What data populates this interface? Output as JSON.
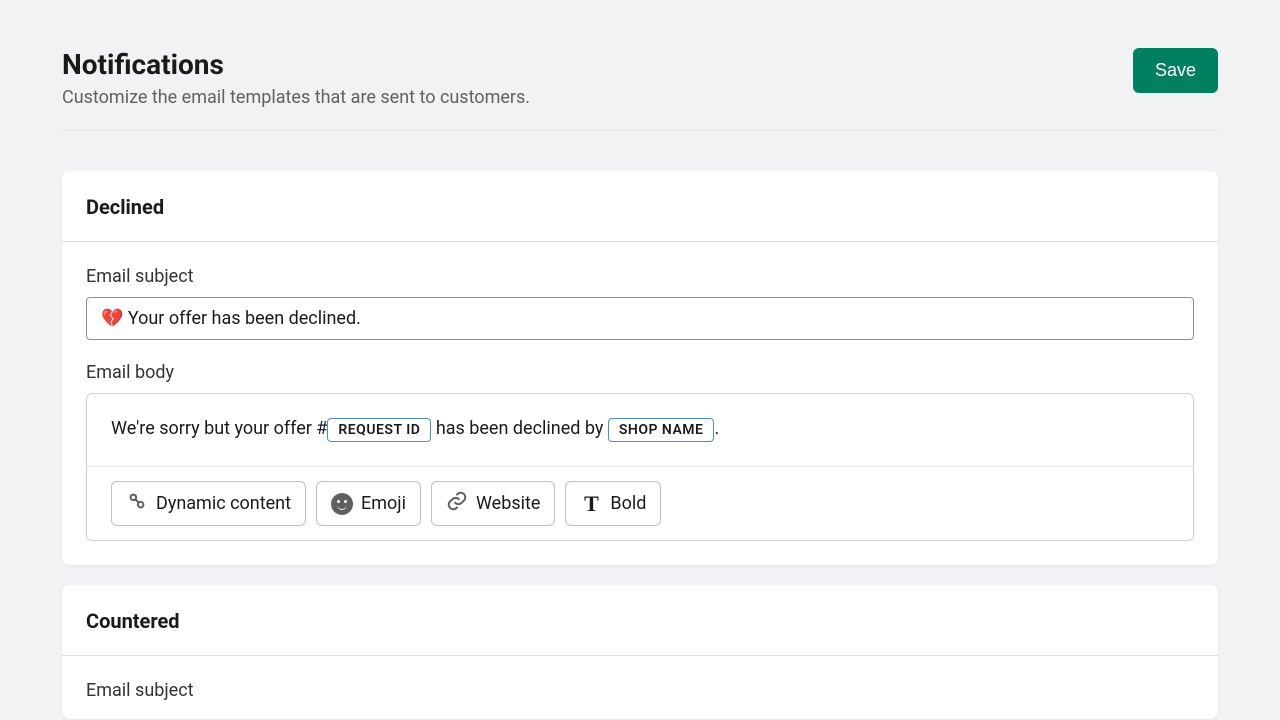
{
  "header": {
    "title": "Notifications",
    "subtitle": "Customize the email templates that are sent to customers.",
    "save_label": "Save"
  },
  "cards": {
    "declined": {
      "title": "Declined",
      "subject_label": "Email subject",
      "subject_value": "💔 Your offer has been declined.",
      "body_label": "Email body",
      "body_parts": {
        "pre": "We're sorry but your offer #",
        "token1": "REQUEST ID",
        "mid": " has been declined by ",
        "token2": "SHOP NAME",
        "post": "."
      }
    },
    "countered": {
      "title": "Countered",
      "subject_label": "Email subject"
    }
  },
  "toolbar": {
    "dynamic": "Dynamic content",
    "emoji": "Emoji",
    "website": "Website",
    "bold": "Bold"
  }
}
